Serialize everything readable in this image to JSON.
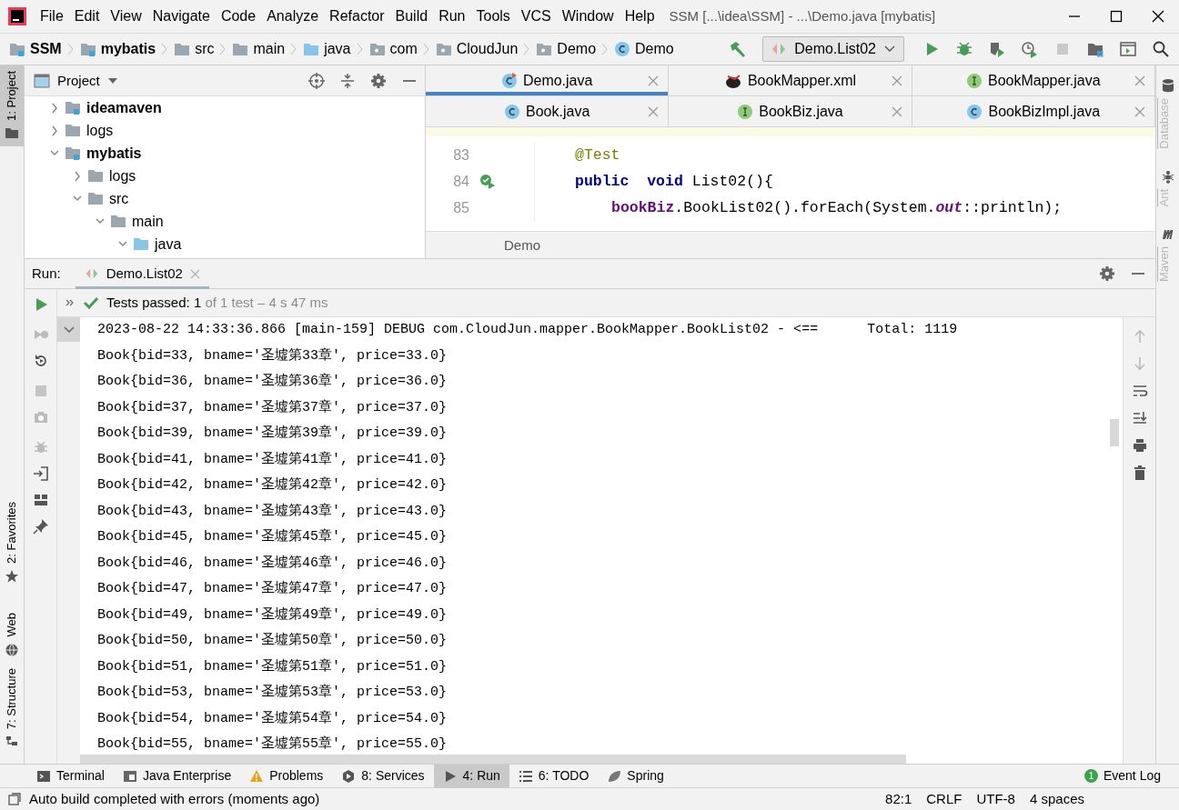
{
  "menu": [
    "File",
    "Edit",
    "View",
    "Navigate",
    "Code",
    "Analyze",
    "Refactor",
    "Build",
    "Run",
    "Tools",
    "VCS",
    "Window",
    "Help"
  ],
  "window_title": "SSM [...\\idea\\SSM] - ...\\Demo.java [mybatis]",
  "breadcrumbs": [
    {
      "label": "SSM",
      "kind": "module"
    },
    {
      "label": "mybatis",
      "kind": "module"
    },
    {
      "label": "src",
      "kind": "folder"
    },
    {
      "label": "main",
      "kind": "folder"
    },
    {
      "label": "java",
      "kind": "source"
    },
    {
      "label": "com",
      "kind": "package"
    },
    {
      "label": "CloudJun",
      "kind": "package"
    },
    {
      "label": "Demo",
      "kind": "package"
    },
    {
      "label": "Demo",
      "kind": "class"
    }
  ],
  "run_config": "Demo.List02",
  "left_tool_tabs": [
    {
      "label": "1: Project",
      "selected": true
    },
    {
      "label": "2: Favorites",
      "selected": false
    },
    {
      "label": "Web",
      "selected": false
    },
    {
      "label": "7: Structure",
      "selected": false
    }
  ],
  "right_tool_tabs": [
    "Database",
    "Ant",
    "Maven"
  ],
  "project_panel": {
    "title": "Project",
    "tree": [
      {
        "label": "ideamaven",
        "kind": "module",
        "expanded": false
      },
      {
        "label": "logs",
        "kind": "folder",
        "expanded": false
      },
      {
        "label": "mybatis",
        "kind": "module",
        "expanded": true,
        "children": [
          {
            "label": "logs",
            "kind": "folder",
            "expanded": false
          },
          {
            "label": "src",
            "kind": "folder",
            "expanded": true,
            "children": [
              {
                "label": "main",
                "kind": "folder",
                "expanded": true,
                "children": [
                  {
                    "label": "java",
                    "kind": "source",
                    "expanded": true
                  }
                ]
              }
            ]
          }
        ]
      }
    ]
  },
  "editor": {
    "tab_rows": [
      [
        {
          "label": "Demo.java",
          "kind": "main",
          "selected": true
        },
        {
          "label": "BookMapper.xml",
          "kind": "xml",
          "selected": false
        },
        {
          "label": "BookMapper.java",
          "kind": "interface",
          "selected": false
        }
      ],
      [
        {
          "label": "Book.java",
          "kind": "class",
          "selected": false
        },
        {
          "label": "BookBiz.java",
          "kind": "interface",
          "selected": false
        },
        {
          "label": "BookBizImpl.java",
          "kind": "class",
          "selected": false
        }
      ]
    ],
    "lines": [
      {
        "number": "83",
        "run_marker": false,
        "tokens": [
          {
            "text": "@Test",
            "kind": "annotation"
          }
        ]
      },
      {
        "number": "84",
        "run_marker": true,
        "tokens": [
          {
            "text": "public  void",
            "kind": "keyword"
          },
          {
            "text": " List02(){",
            "kind": "plain"
          }
        ],
        "children": [
          {
            "number": "85",
            "run_marker": false,
            "tokens": [
              {
                "text": "bookBiz",
                "kind": "field"
              },
              {
                "text": ".BookList02().forEach(System.",
                "kind": "plain"
              },
              {
                "text": "out",
                "kind": "static"
              },
              {
                "text": "::println);",
                "kind": "plain"
              }
            ]
          }
        ]
      }
    ],
    "breadcrumb": "Demo"
  },
  "run_panel": {
    "label": "Run:",
    "tab": "Demo.List02",
    "status_main": "Tests passed: 1",
    "status_detail": "of 1 test – 4 s 47 ms",
    "console": [
      "2023-08-22 14:33:36.866 [main-159] DEBUG com.CloudJun.mapper.BookMapper.BookList02 - <==      Total: 1119",
      "Book{bid=33, bname='圣墟第33章', price=33.0}",
      "Book{bid=36, bname='圣墟第36章', price=36.0}",
      "Book{bid=37, bname='圣墟第37章', price=37.0}",
      "Book{bid=39, bname='圣墟第39章', price=39.0}",
      "Book{bid=41, bname='圣墟第41章', price=41.0}",
      "Book{bid=42, bname='圣墟第42章', price=42.0}",
      "Book{bid=43, bname='圣墟第43章', price=43.0}",
      "Book{bid=45, bname='圣墟第45章', price=45.0}",
      "Book{bid=46, bname='圣墟第46章', price=46.0}",
      "Book{bid=47, bname='圣墟第47章', price=47.0}",
      "Book{bid=49, bname='圣墟第49章', price=49.0}",
      "Book{bid=50, bname='圣墟第50章', price=50.0}",
      "Book{bid=51, bname='圣墟第51章', price=51.0}",
      "Book{bid=53, bname='圣墟第53章', price=53.0}",
      "Book{bid=54, bname='圣墟第54章', price=54.0}",
      "Book{bid=55, bname='圣墟第55章', price=55.0}"
    ]
  },
  "tool_window_bar": [
    {
      "label": "Terminal",
      "kind": "terminal",
      "selected": false
    },
    {
      "label": "Java Enterprise",
      "kind": "enterprise",
      "selected": false
    },
    {
      "label": "Problems",
      "kind": "problems",
      "selected": false
    },
    {
      "label": "8: Services",
      "kind": "services",
      "selected": false
    },
    {
      "label": "4: Run",
      "kind": "run",
      "selected": true
    },
    {
      "label": "6: TODO",
      "kind": "todo",
      "selected": false
    },
    {
      "label": "Spring",
      "kind": "spring",
      "selected": false
    }
  ],
  "event_log": {
    "label": "Event Log",
    "count": "1"
  },
  "status_bar": {
    "message": "Auto build completed with errors (moments ago)",
    "items": [
      "82:1",
      "CRLF",
      "UTF-8",
      "4 spaces"
    ]
  }
}
